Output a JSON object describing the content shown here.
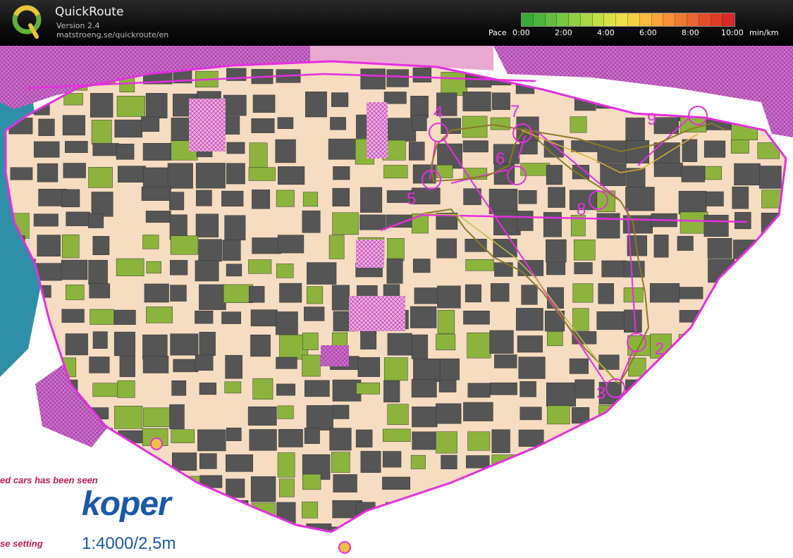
{
  "app": {
    "title": "QuickRoute",
    "version": "Version 2.4",
    "url": "matstroeng.se/quickroute/en"
  },
  "pace_scale": {
    "label": "Pace",
    "ticks": [
      "0:00",
      "2:00",
      "4:00",
      "6:00",
      "8:00",
      "10:00"
    ],
    "unit": "min/km",
    "colors": [
      "#3aa83a",
      "#4db33c",
      "#62bd3e",
      "#79c640",
      "#92cf42",
      "#abd744",
      "#c3de46",
      "#d9e248",
      "#ecdf48",
      "#f5cf44",
      "#f8bb3f",
      "#f8a63a",
      "#f59036",
      "#f17a32",
      "#ec642f",
      "#e64f2c",
      "#df3b29",
      "#d82a27"
    ]
  },
  "map": {
    "name": "koper",
    "scale": "1:4000/2,5m",
    "note_cars": "ed cars has been seen",
    "note_setting": "se setting",
    "controls": [
      {
        "number": "2"
      },
      {
        "number": "3"
      },
      {
        "number": "4"
      },
      {
        "number": "5"
      },
      {
        "number": "6"
      },
      {
        "number": "7"
      },
      {
        "number": "8"
      },
      {
        "number": "9"
      }
    ]
  },
  "colors": {
    "course": "#e52fe0",
    "building": "#555555",
    "paved": "#f6dcc0",
    "green": "#8cb43c",
    "water": "#2e8fa8"
  }
}
